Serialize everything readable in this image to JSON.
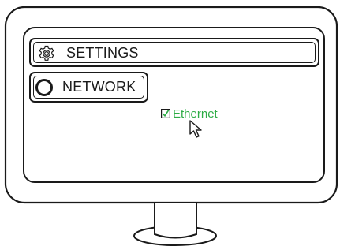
{
  "settings": {
    "label": "SETTINGS",
    "icon": "gear-icon"
  },
  "network": {
    "label": "NETWORK",
    "icon": "ring-icon"
  },
  "ethernet": {
    "label": "Ethernet",
    "checked": true,
    "color": "#2dac45"
  },
  "colors": {
    "outline": "#1a1a1a",
    "accent": "#2dac45",
    "background": "#ffffff"
  }
}
